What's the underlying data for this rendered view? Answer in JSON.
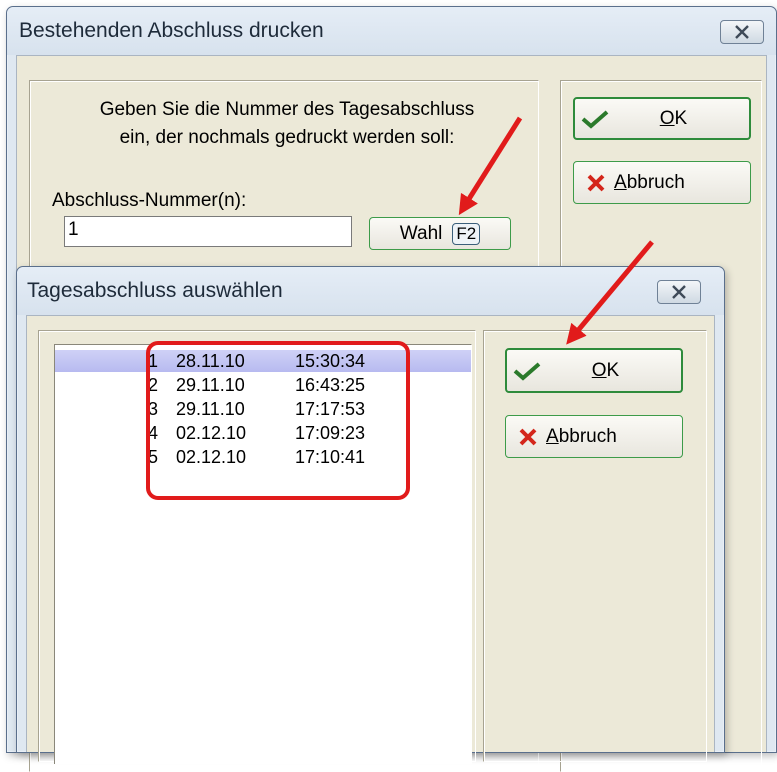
{
  "back_dialog": {
    "title": "Bestehenden Abschluss drucken",
    "instruction_line1": "Geben Sie die Nummer des Tagesabschluss",
    "instruction_line2": "ein, der nochmals gedruckt werden soll:",
    "field_label": "Abschluss-Nummer(n):",
    "field_value": "1",
    "wahl_label": "Wahl",
    "wahl_key": "F2",
    "ok_mnemonic": "O",
    "ok_rest": "K",
    "cancel_mnemonic": "A",
    "cancel_rest": "bbruch"
  },
  "front_dialog": {
    "title": "Tagesabschluss auswählen",
    "ok_mnemonic": "O",
    "ok_rest": "K",
    "cancel_mnemonic": "A",
    "cancel_rest": "bbruch",
    "rows": [
      {
        "nr": "1",
        "date": "28.11.10",
        "time": "15:30:34",
        "selected": true
      },
      {
        "nr": "2",
        "date": "29.11.10",
        "time": "16:43:25",
        "selected": false
      },
      {
        "nr": "3",
        "date": "29.11.10",
        "time": "17:17:53",
        "selected": false
      },
      {
        "nr": "4",
        "date": "02.12.10",
        "time": "17:09:23",
        "selected": false
      },
      {
        "nr": "5",
        "date": "02.12.10",
        "time": "17:10:41",
        "selected": false
      }
    ]
  },
  "colors": {
    "annotation_red": "#e11b1b",
    "button_green": "#2e8b3b",
    "selection_blue": "#b7baf0",
    "dialog_face": "#ece9d8"
  }
}
